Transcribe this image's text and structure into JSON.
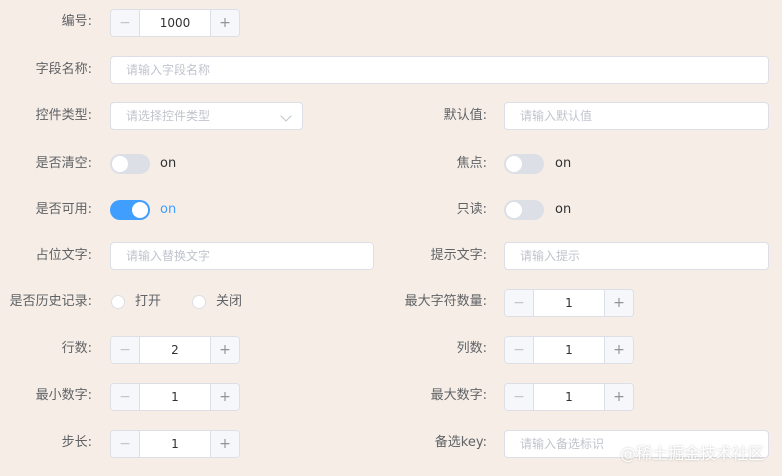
{
  "form": {
    "number": {
      "label": "编号:",
      "value": "1000",
      "minus": "−",
      "plus": "+"
    },
    "field_name": {
      "label": "字段名称:",
      "placeholder": "请输入字段名称"
    },
    "control_type": {
      "label": "控件类型:",
      "placeholder": "请选择控件类型"
    },
    "default_value": {
      "label": "默认值:",
      "placeholder": "请输入默认值"
    },
    "clearable": {
      "label": "是否清空:",
      "state": "on",
      "enabled": false
    },
    "focus": {
      "label": "焦点:",
      "state": "on",
      "enabled": false
    },
    "available": {
      "label": "是否可用:",
      "state": "on",
      "enabled": true
    },
    "readonly": {
      "label": "只读:",
      "state": "on",
      "enabled": false
    },
    "placeholder_text": {
      "label": "占位文字:",
      "placeholder": "请输入替换文字"
    },
    "hint_text": {
      "label": "提示文字:",
      "placeholder": "请输入提示"
    },
    "history": {
      "label": "是否历史记录:",
      "options": [
        "打开",
        "关闭"
      ]
    },
    "max_chars": {
      "label": "最大字符数量:",
      "value": "1",
      "minus": "−",
      "plus": "+"
    },
    "rows": {
      "label": "行数:",
      "value": "2",
      "minus": "−",
      "plus": "+"
    },
    "cols": {
      "label": "列数:",
      "value": "1",
      "minus": "−",
      "plus": "+"
    },
    "min_num": {
      "label": "最小数字:",
      "value": "1",
      "minus": "−",
      "plus": "+"
    },
    "max_num": {
      "label": "最大数字:",
      "value": "1",
      "minus": "−",
      "plus": "+"
    },
    "step": {
      "label": "步长:",
      "value": "1",
      "minus": "−",
      "plus": "+"
    },
    "alt_key": {
      "label": "备选key:",
      "placeholder": "请输入备选标识"
    }
  },
  "watermark": "@稀土掘金技术社区",
  "colors": {
    "accent": "#409eff",
    "background": "#f5ede6",
    "border": "#dcdfe6"
  }
}
